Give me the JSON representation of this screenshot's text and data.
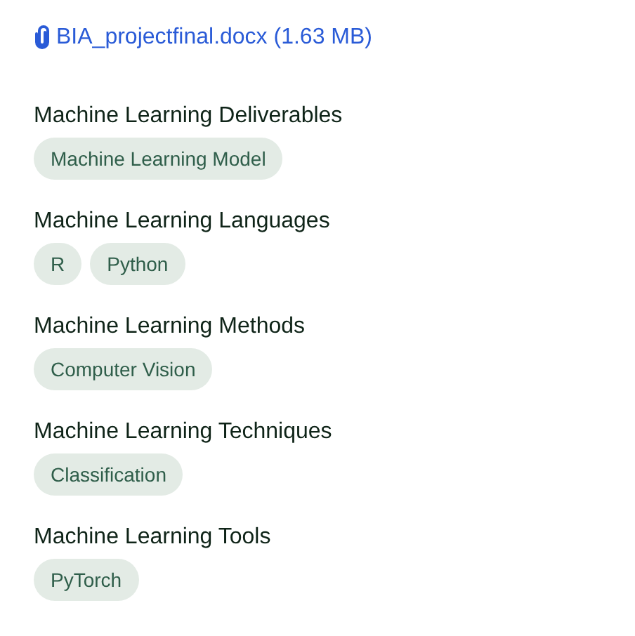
{
  "attachment": {
    "label": "BIA_projectfinal.docx (1.63 MB)"
  },
  "sections": [
    {
      "title": "Machine Learning Deliverables",
      "tags": [
        "Machine Learning Model"
      ]
    },
    {
      "title": "Machine Learning Languages",
      "tags": [
        "R",
        "Python"
      ]
    },
    {
      "title": "Machine Learning Methods",
      "tags": [
        "Computer Vision"
      ]
    },
    {
      "title": "Machine Learning Techniques",
      "tags": [
        "Classification"
      ]
    },
    {
      "title": "Machine Learning Tools",
      "tags": [
        "PyTorch"
      ]
    }
  ]
}
